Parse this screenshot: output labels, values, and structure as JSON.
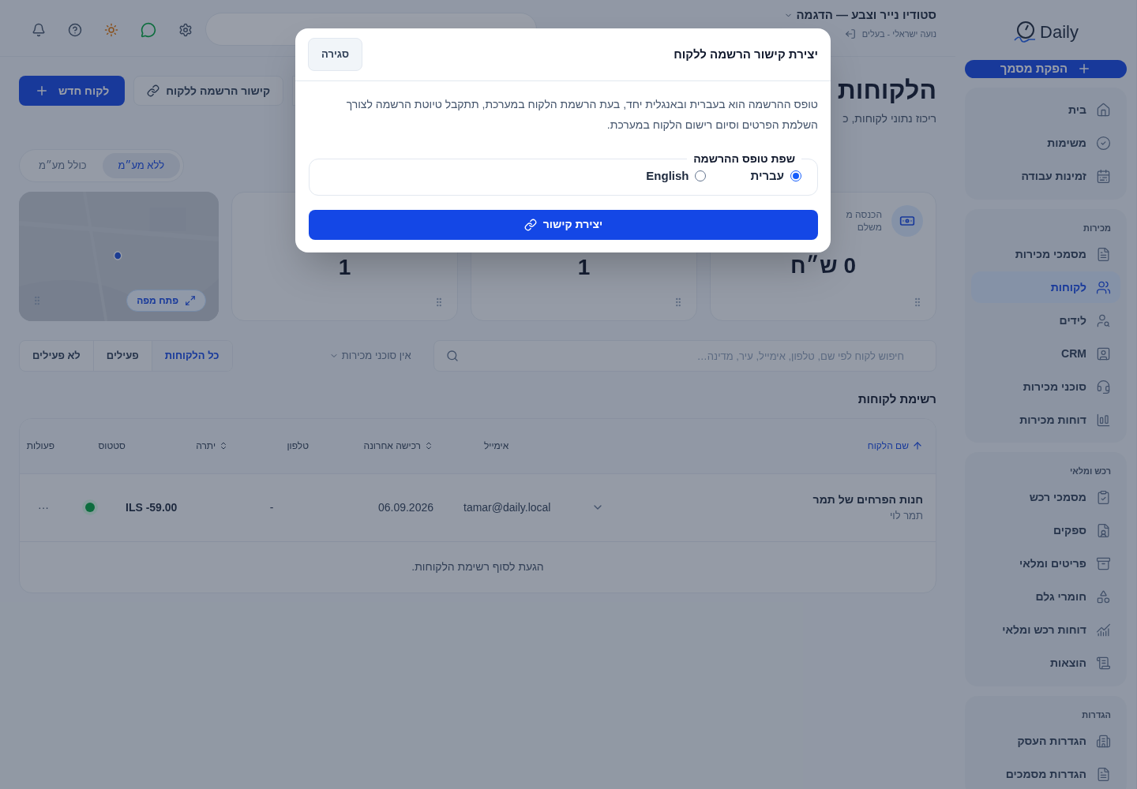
{
  "sidebar": {
    "logo": "Daily",
    "primary_action": "הפקת מסמך",
    "sections": [
      {
        "items": [
          {
            "label": "בית",
            "selected": false
          },
          {
            "label": "משימות",
            "selected": false
          },
          {
            "label": "זמינות עבודה",
            "selected": false
          }
        ]
      },
      {
        "title": "מכירות",
        "items": [
          {
            "label": "מסמכי מכירות",
            "selected": false
          },
          {
            "label": "לקוחות",
            "selected": true
          },
          {
            "label": "לידים",
            "selected": false
          },
          {
            "label": "CRM",
            "selected": false
          },
          {
            "label": "סוכני מכירות",
            "selected": false
          },
          {
            "label": "דוחות מכירות",
            "selected": false
          }
        ]
      },
      {
        "title": "רכש ומלאי",
        "items": [
          {
            "label": "מסמכי רכש",
            "selected": false
          },
          {
            "label": "ספקים",
            "selected": false
          },
          {
            "label": "פריטים ומלאי",
            "selected": false
          },
          {
            "label": "חומרי גלם",
            "selected": false
          },
          {
            "label": "דוחות רכש ומלאי",
            "selected": false
          },
          {
            "label": "הוצאות",
            "selected": false
          }
        ]
      },
      {
        "title": "הגדרות",
        "items": [
          {
            "label": "הגדרות העסק",
            "selected": false
          },
          {
            "label": "הגדרות מסמכים",
            "selected": false
          }
        ]
      }
    ]
  },
  "header": {
    "business": "סטודיו נייר וצבע — הדגמה",
    "user": "נועה ישראלי - בעלים"
  },
  "page": {
    "title": "הלקוחות",
    "subtitle": "ריכוז נתוני לקוחות, כ",
    "actions": [
      {
        "kind": "upload"
      },
      {
        "label": "קישור הרשמה ללקוח",
        "kind": "link"
      },
      {
        "label": "לקוח חדש",
        "kind": "primary"
      }
    ],
    "vat_toggle": [
      {
        "label": "ללא מע״מ",
        "selected": true
      },
      {
        "label": "כולל מע״מ",
        "selected": false
      }
    ],
    "stats": [
      {
        "label": "הכנסה מ\nמשלם",
        "value": "0 ש״ח",
        "kind": "money"
      },
      {
        "value": "1",
        "kind": "plain"
      },
      {
        "value": "1",
        "kind": "plain"
      },
      {
        "kind": "map",
        "button": "פתח מפה"
      }
    ],
    "filters": [
      {
        "label": "כל הלקוחות",
        "selected": true
      },
      {
        "label": "פעילים",
        "selected": false
      },
      {
        "label": "לא פעילים",
        "selected": false
      }
    ],
    "agents_dropdown": "אין סוכני מכירות",
    "search": {
      "placeholder": "חיפוש לקוח לפי שם, טלפון, אימייל, עיר, מדינה…"
    }
  },
  "table": {
    "title": "רשימת לקוחות",
    "columns": [
      {
        "label": "שם הלקוח",
        "sorted": true,
        "sortable": true
      },
      {
        "label": "אימייל",
        "sorted": false,
        "sortable": false
      },
      {
        "label": "רכישה אחרונה",
        "sorted": false,
        "sortable": true
      },
      {
        "label": "טלפון",
        "sorted": false,
        "sortable": false
      },
      {
        "label": "יתרה",
        "sorted": false,
        "sortable": true
      },
      {
        "label": "סטטוס",
        "sorted": false,
        "sortable": false
      },
      {
        "label": "פעולות",
        "sorted": false,
        "sortable": false
      }
    ],
    "rows": [
      {
        "name": "חנות הפרחים של תמר",
        "contact": "תמר לוי",
        "email": "tamar@daily.local",
        "last_purchase": "06.09.2026",
        "phone": "-",
        "balance": "ILS -59.00",
        "active": true,
        "actions": "···"
      }
    ],
    "footer": "הגעת לסוף רשימת הלקוחות."
  },
  "modal": {
    "title": "יצירת קישור הרשמה ללקוח",
    "close": "סגירה",
    "description": "טופס ההרשמה הוא בעברית ובאנגלית יחד, בעת הרשמת הלקוח במערכת, תתקבל טיוטת הרשמה לצורך השלמת הפרטים וסיום רישום הלקוח במערכת.",
    "legend": "שפת טופס ההרשמה",
    "options": [
      {
        "label": "עברית",
        "selected": true
      },
      {
        "label": "English",
        "selected": false
      }
    ],
    "submit": "יצירת קישור"
  }
}
